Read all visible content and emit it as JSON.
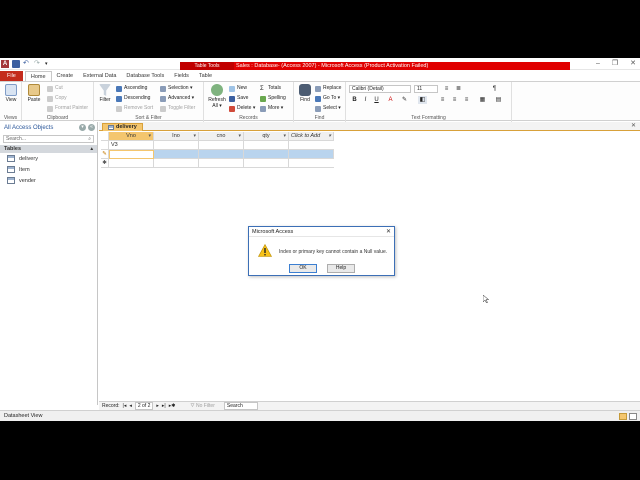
{
  "window": {
    "contextual_tab_group": "Table Tools",
    "title": "Sales : Database- (Access 2007) - Microsoft Access (Product Activation Failed)",
    "controls": [
      "–",
      "❐",
      "✕"
    ]
  },
  "tabs": [
    {
      "label": "File"
    },
    {
      "label": "Home"
    },
    {
      "label": "Create"
    },
    {
      "label": "External Data"
    },
    {
      "label": "Database Tools"
    },
    {
      "label": "Fields"
    },
    {
      "label": "Table"
    }
  ],
  "ribbon": {
    "views": {
      "label": "Views",
      "view": "View"
    },
    "clipboard": {
      "label": "Clipboard",
      "paste": "Paste",
      "cut": "Cut",
      "copy": "Copy",
      "format_painter": "Format Painter"
    },
    "sort_filter": {
      "label": "Sort & Filter",
      "filter": "Filter",
      "ascending": "Ascending",
      "descending": "Descending",
      "remove_sort": "Remove Sort",
      "selection": "Selection ▾",
      "advanced": "Advanced ▾",
      "toggle_filter": "Toggle Filter"
    },
    "records": {
      "label": "Records",
      "refresh": "Refresh All ▾",
      "new": "New",
      "save": "Save",
      "delete": "Delete ▾",
      "totals": "Totals",
      "spelling": "Spelling",
      "more": "More ▾"
    },
    "find": {
      "label": "Find",
      "find": "Find",
      "replace": "Replace",
      "go_to": "Go To ▾",
      "select": "Select ▾"
    },
    "text_formatting": {
      "label": "Text Formatting",
      "font": "Calibri (Detail)",
      "size": "11"
    }
  },
  "nav_pane": {
    "title": "All Access Objects",
    "search_placeholder": "Search...",
    "group": "Tables",
    "items": [
      {
        "label": "delivery"
      },
      {
        "label": "Item"
      },
      {
        "label": "vender"
      }
    ]
  },
  "document": {
    "tab_label": "delivery",
    "columns": [
      "Vno",
      "Ino",
      "cno",
      "qty",
      "Click to Add"
    ],
    "rows": [
      {
        "selector": "",
        "cells": [
          "V3",
          "",
          "",
          "",
          ""
        ]
      },
      {
        "selector": "✎",
        "cells": [
          "",
          "",
          "",
          "",
          ""
        ]
      },
      {
        "selector": "✱",
        "cells": [
          "",
          "",
          "",
          "",
          ""
        ]
      }
    ]
  },
  "dialog": {
    "title": "Microsoft Access",
    "message": "Index or primary key cannot contain a Null value.",
    "ok": "OK",
    "help": "Help"
  },
  "record_nav": {
    "label": "Record:",
    "position": "2 of 2",
    "filter": "No Filter",
    "search": "Search"
  },
  "status": {
    "text": "Datasheet View"
  },
  "colors": {
    "file_tab": "#c42b1c",
    "contextual": "#e00000",
    "active_column": "#f4c66e",
    "selected_row": "#b9d4ee"
  }
}
